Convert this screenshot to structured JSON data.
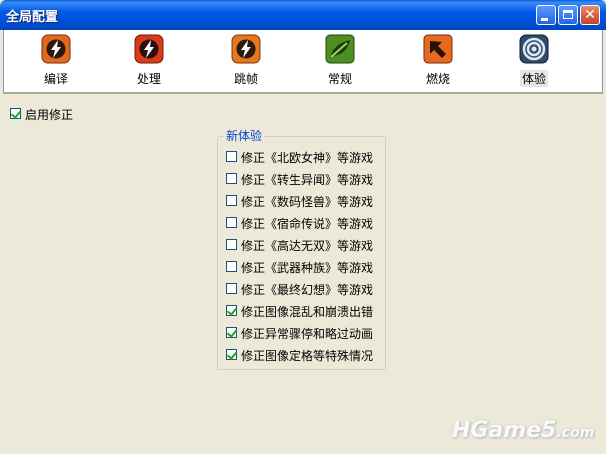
{
  "window": {
    "title": "全局配置"
  },
  "toolbar": {
    "items": [
      {
        "label": "编译",
        "icon": "lightning-icon",
        "color": "#e2691e"
      },
      {
        "label": "处理",
        "icon": "lightning-icon",
        "color": "#d93a1a"
      },
      {
        "label": "跳帧",
        "icon": "lightning-icon",
        "color": "#e8771c"
      },
      {
        "label": "常规",
        "icon": "leaf-icon",
        "color": "#4f8f22"
      },
      {
        "label": "燃烧",
        "icon": "arrow-icon",
        "color": "#e86a20"
      },
      {
        "label": "体验",
        "icon": "target-icon",
        "color": "#2d4c6e"
      }
    ],
    "selected": "体验"
  },
  "main": {
    "enable_label": "启用修正",
    "enable_checked": true,
    "group_title": "新体验",
    "options": [
      {
        "label": "修正《北欧女神》等游戏",
        "checked": false
      },
      {
        "label": "修正《转生异闻》等游戏",
        "checked": false
      },
      {
        "label": "修正《数码怪兽》等游戏",
        "checked": false
      },
      {
        "label": "修正《宿命传说》等游戏",
        "checked": false
      },
      {
        "label": "修正《高达无双》等游戏",
        "checked": false
      },
      {
        "label": "修正《武器种族》等游戏",
        "checked": false
      },
      {
        "label": "修正《最终幻想》等游戏",
        "checked": false
      },
      {
        "label": "修正图像混乱和崩溃出错",
        "checked": true
      },
      {
        "label": "修正异常骤停和略过动画",
        "checked": true
      },
      {
        "label": "修正图像定格等特殊情况",
        "checked": true
      }
    ]
  },
  "watermark": {
    "text": "HGame5",
    "suffix": ".com"
  }
}
